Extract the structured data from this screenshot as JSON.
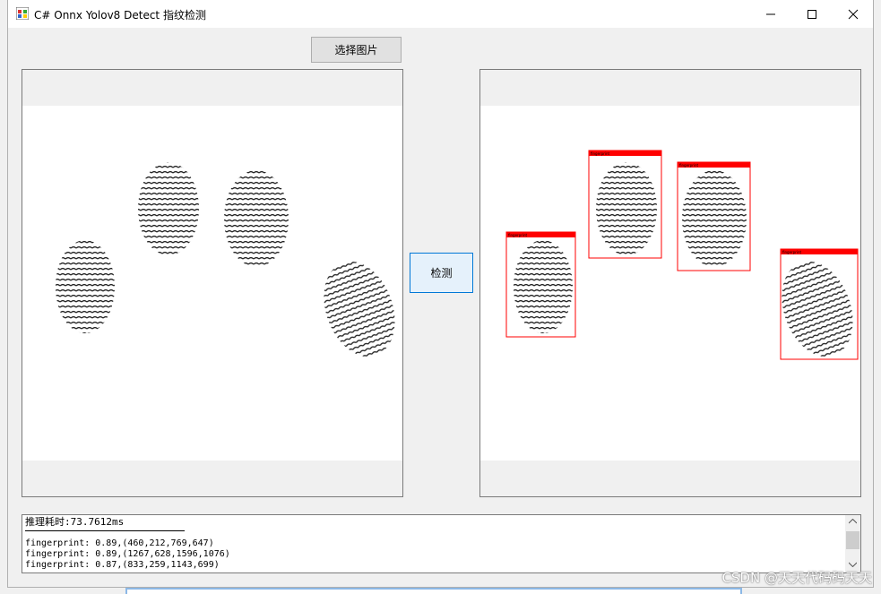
{
  "window": {
    "title": "C# Onnx Yolov8 Detect 指纹检测"
  },
  "toolbar": {
    "select_label": "选择图片",
    "detect_label": "检测"
  },
  "output": {
    "lines": [
      "推理耗时:73.7612ms",
      "fingerprint: 0.89,(460,212,769,647)",
      "fingerprint: 0.89,(1267,628,1596,1076)",
      "fingerprint: 0.87,(833,259,1143,699)"
    ]
  },
  "detections": [
    {
      "label": "fingerprint",
      "score": "0.89"
    },
    {
      "label": "fingerprint",
      "score": "0.89"
    },
    {
      "label": "fingerprint",
      "score": "0.87"
    },
    {
      "label": "fingerprint",
      "score": "0.89"
    }
  ],
  "colors": {
    "box": "#ff0000",
    "accent": "#0078d7"
  },
  "watermark": "CSDN @天天代码码天天"
}
